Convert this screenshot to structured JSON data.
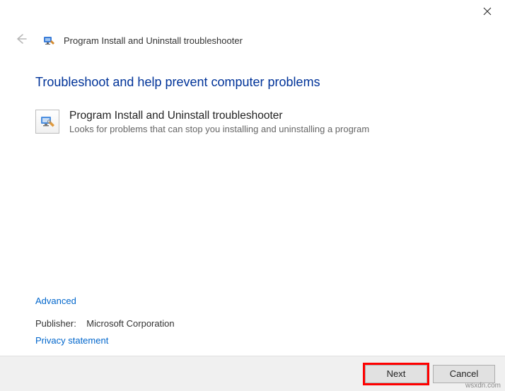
{
  "window": {
    "title": "Program Install and Uninstall troubleshooter"
  },
  "main": {
    "heading": "Troubleshoot and help prevent computer problems",
    "item": {
      "title": "Program Install and Uninstall troubleshooter",
      "description": "Looks for problems that can stop you installing and uninstalling a program"
    }
  },
  "links": {
    "advanced": "Advanced",
    "privacy": "Privacy statement"
  },
  "publisher": {
    "label": "Publisher:",
    "value": "Microsoft Corporation"
  },
  "buttons": {
    "next": "Next",
    "cancel": "Cancel"
  },
  "watermark": "wsxdn.com"
}
